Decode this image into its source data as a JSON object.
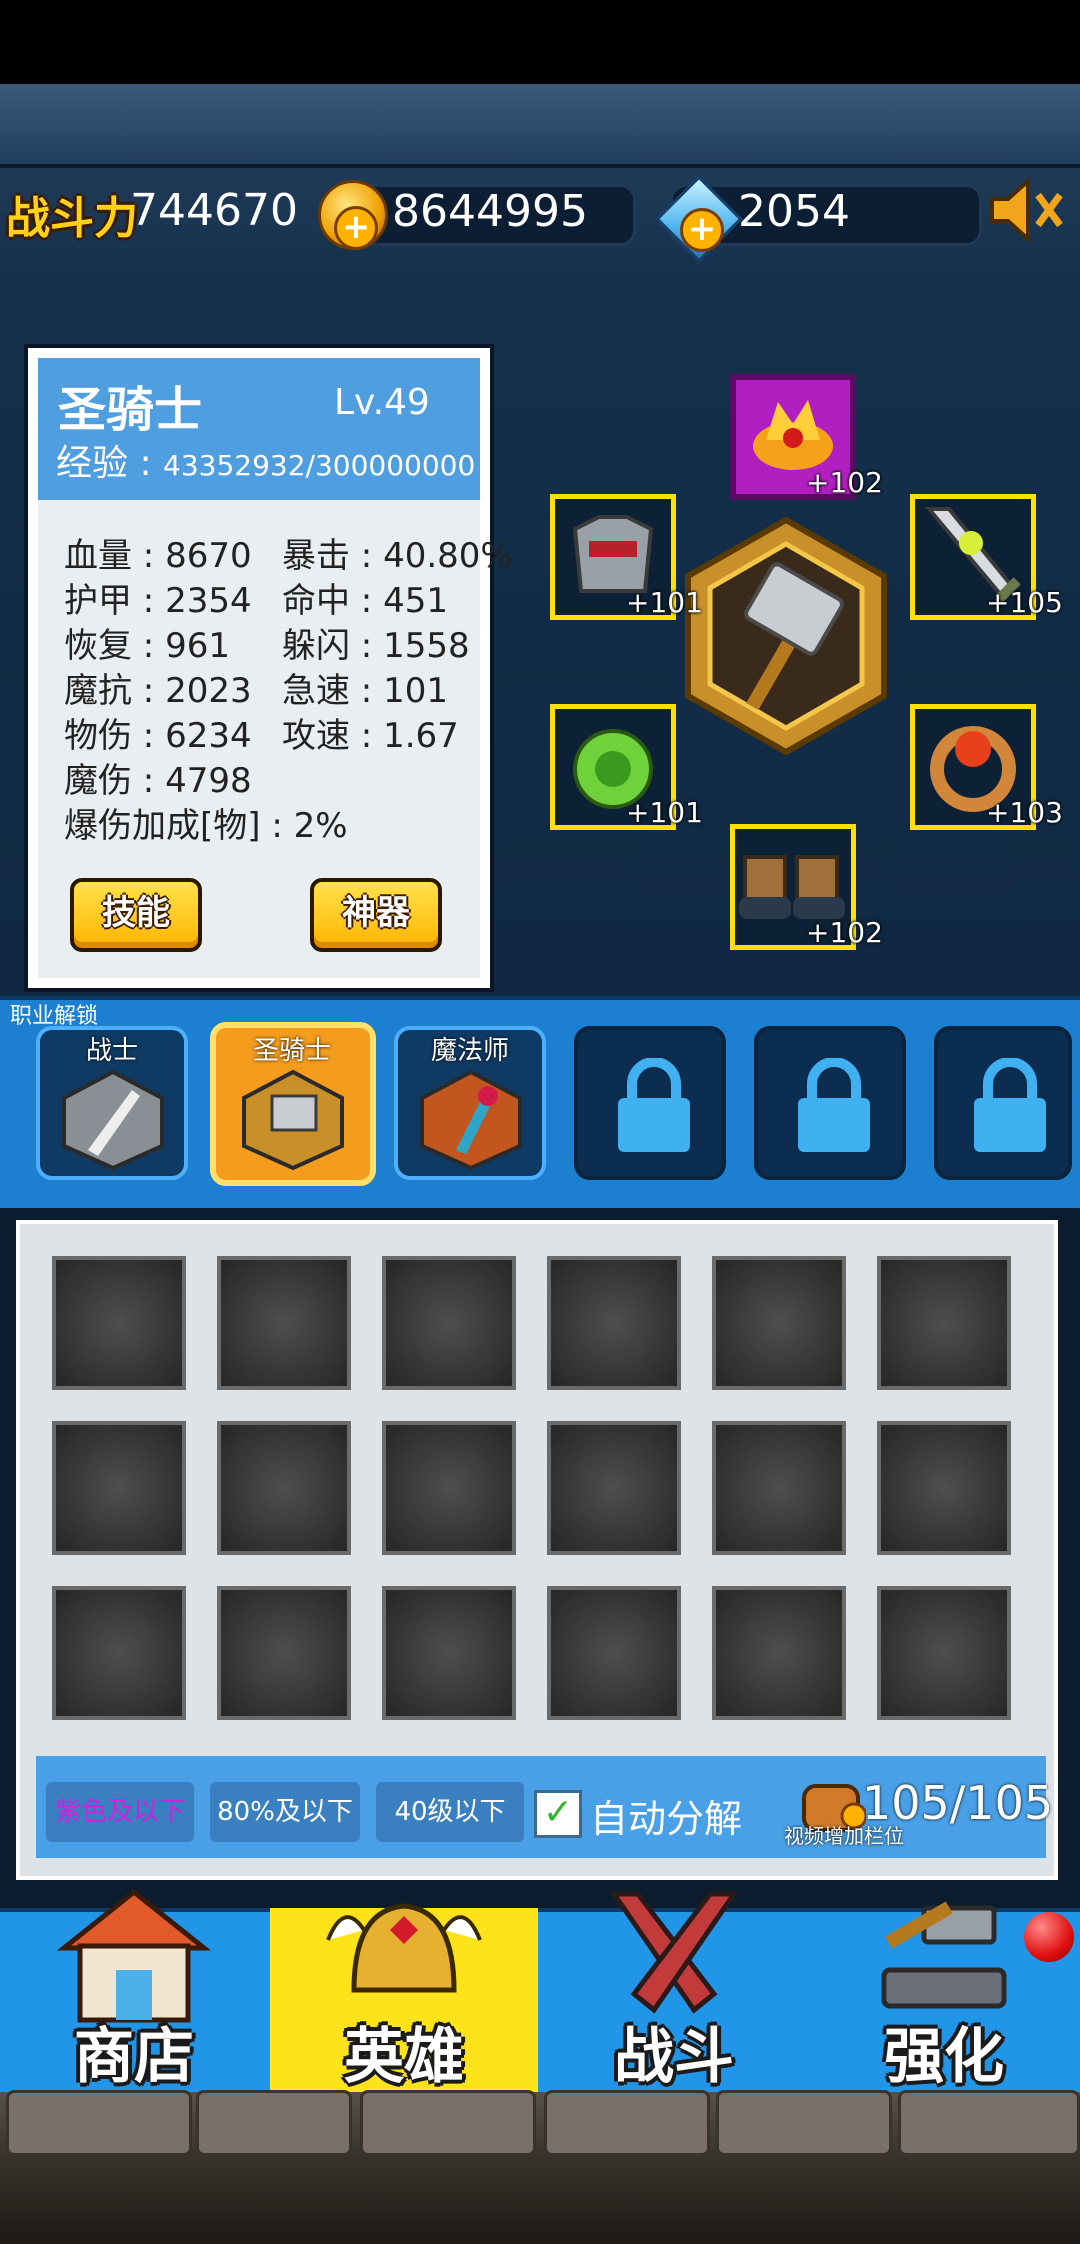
{
  "header": {
    "power_label": "战斗力",
    "power_value": "744670",
    "gold": "8644995",
    "diamonds": "2054"
  },
  "hero": {
    "name": "圣骑士",
    "level": "Lv.49",
    "exp_label": "经验",
    "exp_value": "43352932/300000000",
    "stats_left": [
      {
        "label": "血量",
        "value": "8670"
      },
      {
        "label": "护甲",
        "value": "2354"
      },
      {
        "label": "恢复",
        "value": "961"
      },
      {
        "label": "魔抗",
        "value": "2023"
      },
      {
        "label": "物伤",
        "value": "6234"
      },
      {
        "label": "魔伤",
        "value": "4798"
      }
    ],
    "stats_right": [
      {
        "label": "暴击",
        "value": "40.80%"
      },
      {
        "label": "命中",
        "value": "451"
      },
      {
        "label": "躲闪",
        "value": "1558"
      },
      {
        "label": "急速",
        "value": "101"
      },
      {
        "label": "攻速",
        "value": "1.67"
      }
    ],
    "extra_stat": {
      "label": "爆伤加成[物]",
      "value": "2%"
    },
    "skill_button": "技能",
    "artifact_button": "神器"
  },
  "equipment": {
    "top": "+102",
    "left_top": "+101",
    "right_top": "+105",
    "left_bottom": "+101",
    "right_bottom": "+103",
    "bottom": "+102"
  },
  "classes": {
    "unlock_label": "职业解锁",
    "items": [
      "战士",
      "圣骑士",
      "魔法师"
    ]
  },
  "inventory": {
    "filter_purple": "紫色及以下",
    "filter_percent": "80%及以下",
    "filter_level": "40级以下",
    "auto_decompose": "自动分解",
    "capacity": "105/105",
    "video_slot": "视频增加栏位"
  },
  "nav": {
    "shop": "商店",
    "hero": "英雄",
    "battle": "战斗",
    "upgrade": "强化"
  },
  "colors": {
    "accent_yellow": "#ffe31a",
    "nav_blue": "#2196e8",
    "slot_border": "#ffe100"
  }
}
